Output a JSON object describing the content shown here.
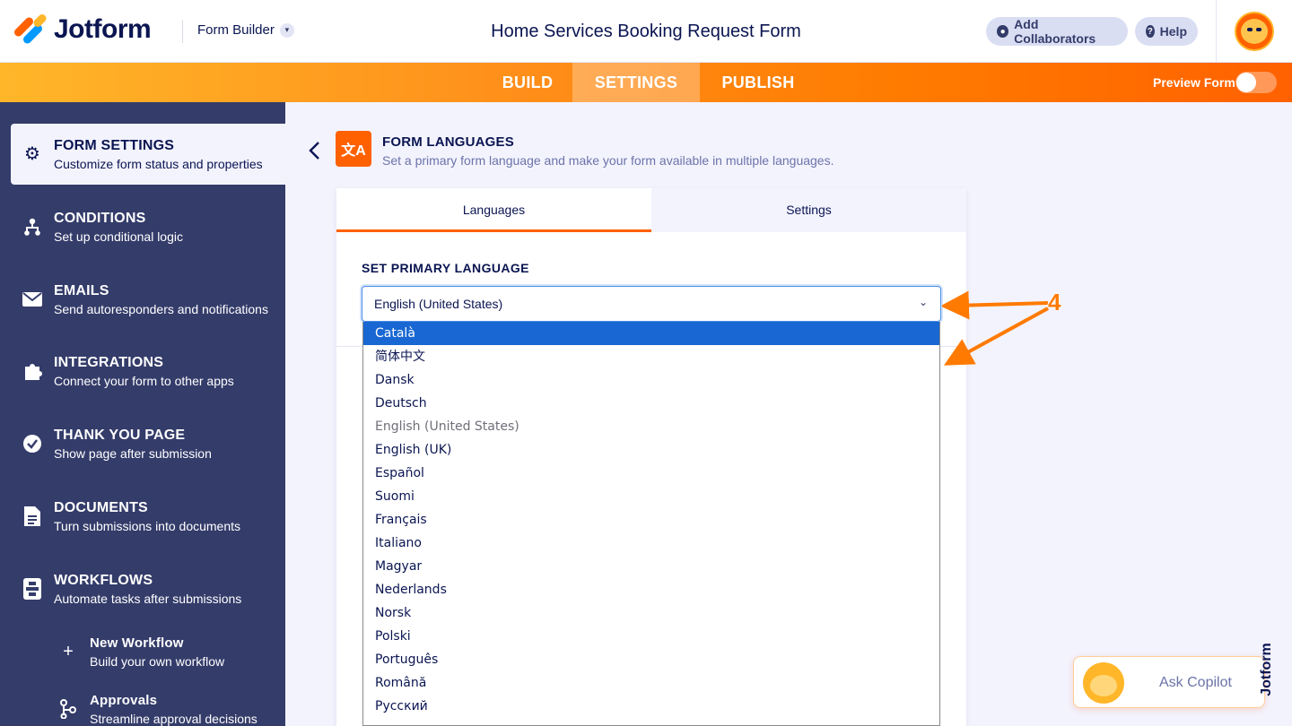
{
  "header": {
    "logo_text": "Jotform",
    "builder_label": "Form Builder",
    "form_title": "Home Services Booking Request Form",
    "add_collaborators": "Add Collaborators",
    "help": "Help"
  },
  "nav": {
    "tabs": [
      "BUILD",
      "SETTINGS",
      "PUBLISH"
    ],
    "active_tab": "SETTINGS",
    "preview_label": "Preview Form",
    "preview_enabled": false
  },
  "sidebar": {
    "items": [
      {
        "title": "FORM SETTINGS",
        "subtitle": "Customize form status and properties",
        "icon": "gear-icon"
      },
      {
        "title": "CONDITIONS",
        "subtitle": "Set up conditional logic",
        "icon": "conditions-icon"
      },
      {
        "title": "EMAILS",
        "subtitle": "Send autoresponders and notifications",
        "icon": "envelope-icon"
      },
      {
        "title": "INTEGRATIONS",
        "subtitle": "Connect your form to other apps",
        "icon": "puzzle-icon"
      },
      {
        "title": "THANK YOU PAGE",
        "subtitle": "Show page after submission",
        "icon": "check-circle-icon"
      },
      {
        "title": "DOCUMENTS",
        "subtitle": "Turn submissions into documents",
        "icon": "document-icon"
      },
      {
        "title": "WORKFLOWS",
        "subtitle": "Automate tasks after submissions",
        "icon": "workflow-icon"
      },
      {
        "title": "New Workflow",
        "subtitle": "Build your own workflow",
        "icon": "plus-icon"
      },
      {
        "title": "Approvals",
        "subtitle": "Streamline approval decisions",
        "icon": "approvals-icon"
      }
    ]
  },
  "section": {
    "title": "FORM LANGUAGES",
    "subtitle": "Set a primary form language and make your form available in multiple languages.",
    "icon_text": "文A"
  },
  "panel": {
    "tabs": [
      "Languages",
      "Settings"
    ],
    "active_tab": "Languages",
    "primary_language_label": "SET PRIMARY LANGUAGE",
    "selected_value": "English (United States)"
  },
  "dropdown": {
    "options": [
      {
        "label": "Català",
        "state": "highlighted"
      },
      {
        "label": "简体中文",
        "state": ""
      },
      {
        "label": "Dansk",
        "state": ""
      },
      {
        "label": "Deutsch",
        "state": ""
      },
      {
        "label": "English (United States)",
        "state": "disabled"
      },
      {
        "label": "English (UK)",
        "state": ""
      },
      {
        "label": "Español",
        "state": ""
      },
      {
        "label": "Suomi",
        "state": ""
      },
      {
        "label": "Français",
        "state": ""
      },
      {
        "label": "Italiano",
        "state": ""
      },
      {
        "label": "Magyar",
        "state": ""
      },
      {
        "label": "Nederlands",
        "state": ""
      },
      {
        "label": "Norsk",
        "state": ""
      },
      {
        "label": "Polski",
        "state": ""
      },
      {
        "label": "Português",
        "state": ""
      },
      {
        "label": "Română",
        "state": ""
      },
      {
        "label": "Русский",
        "state": ""
      }
    ]
  },
  "annotation": {
    "number": "4",
    "color": "#ff7a00"
  },
  "copilot": {
    "label": "Ask Copilot"
  },
  "side_brand": "Jotform",
  "colors": {
    "brand_orange": "#ff6100",
    "sidebar_bg": "#343c6a",
    "navy": "#0a1551",
    "highlight_blue": "#1967d2"
  }
}
